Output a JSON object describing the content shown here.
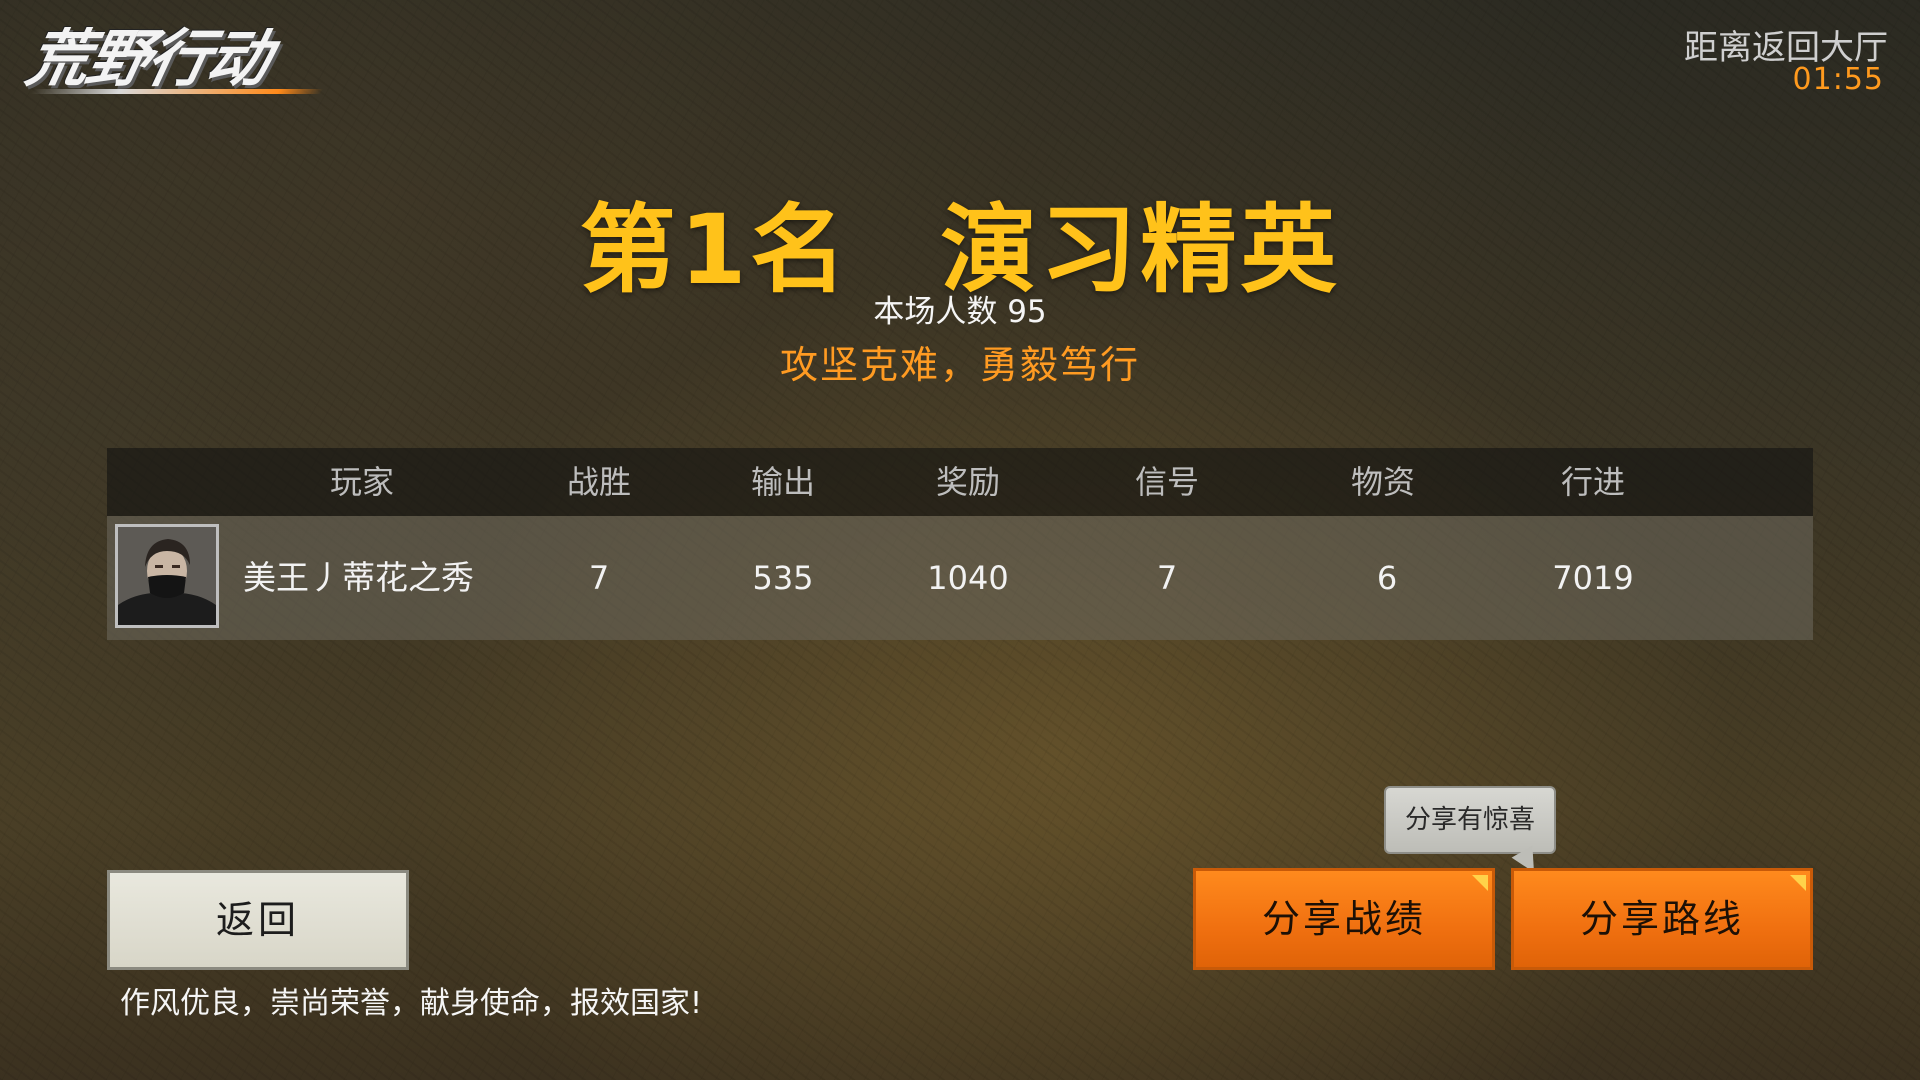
{
  "logo": {
    "text": "荒野行动"
  },
  "timer": {
    "label": "距离返回大厅",
    "value": "01:55"
  },
  "result": {
    "title_rank": "第1名",
    "title_honor": "演习精英",
    "players_label": "本场人数 95",
    "motto": "攻坚克难，勇毅笃行"
  },
  "table": {
    "headers": [
      "玩家",
      "战胜",
      "输出",
      "奖励",
      "信号",
      "物资",
      "行进"
    ],
    "rows": [
      {
        "player": "美王丿蒂花之秀",
        "wins": "7",
        "damage": "535",
        "reward": "1040",
        "signal": "7",
        "supplies": "6",
        "distance": "7019"
      }
    ]
  },
  "buttons": {
    "back": "返回",
    "share_stats": "分享战绩",
    "share_route": "分享路线"
  },
  "tooltip": {
    "text": "分享有惊喜"
  },
  "slogan": "作风优良，崇尚荣誉，献身使命，报效国家!",
  "colors": {
    "accent_gold": "#ffc21a",
    "accent_orange": "#ff9b22",
    "button_orange": "#f07010"
  }
}
